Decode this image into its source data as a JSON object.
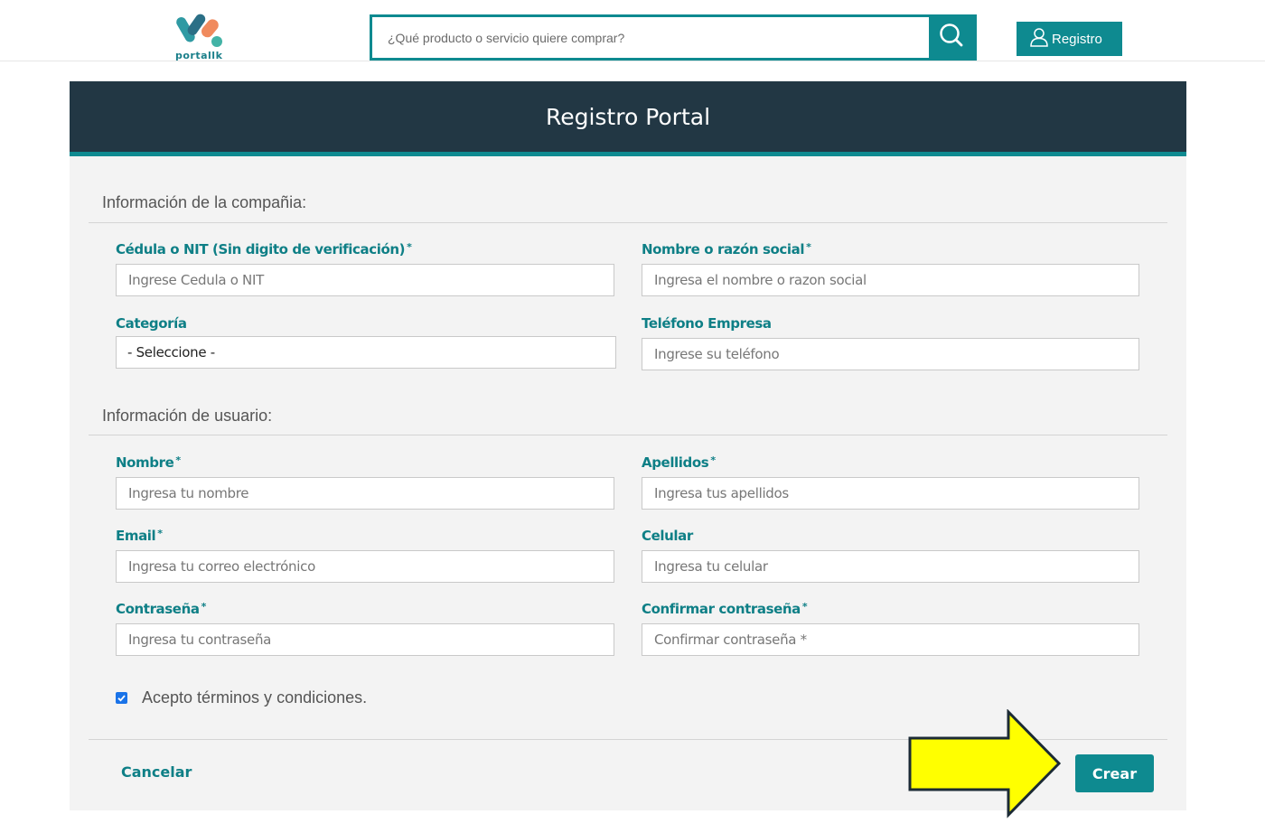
{
  "header": {
    "logo_text": "portallk",
    "search_placeholder": "¿Qué producto o servicio quiere comprar?",
    "register_label": "Registro"
  },
  "card": {
    "title": "Registro Portal",
    "company_section": {
      "title": "Información de la compañia:",
      "nit_label": "Cédula o NIT (Sin digito de verificación)",
      "nit_placeholder": "Ingrese Cedula o NIT",
      "name_label": "Nombre o razón social",
      "name_placeholder": "Ingresa el nombre o razon social",
      "category_label": "Categoría",
      "category_value": "- Seleccione -",
      "phone_label": "Teléfono Empresa",
      "phone_placeholder": "Ingrese su teléfono"
    },
    "user_section": {
      "title": "Información de usuario:",
      "first_name_label": "Nombre",
      "first_name_placeholder": "Ingresa tu nombre",
      "last_name_label": "Apellidos",
      "last_name_placeholder": "Ingresa tus apellidos",
      "email_label": "Email",
      "email_placeholder": "Ingresa tu correo electrónico",
      "mobile_label": "Celular",
      "mobile_placeholder": "Ingresa tu celular",
      "password_label": "Contraseña",
      "password_placeholder": "Ingresa tu contraseña",
      "confirm_label": "Confirmar contraseña",
      "confirm_placeholder": "Confirmar contraseña *"
    },
    "required_mark": "*",
    "terms_label": "Acepto términos y condiciones.",
    "terms_checked": true,
    "cancel_label": "Cancelar",
    "create_label": "Crear"
  },
  "colors": {
    "accent": "#0e8a90",
    "header_dark": "#223744",
    "label": "#0e7f86",
    "annotation_arrow": "#ffff00"
  }
}
